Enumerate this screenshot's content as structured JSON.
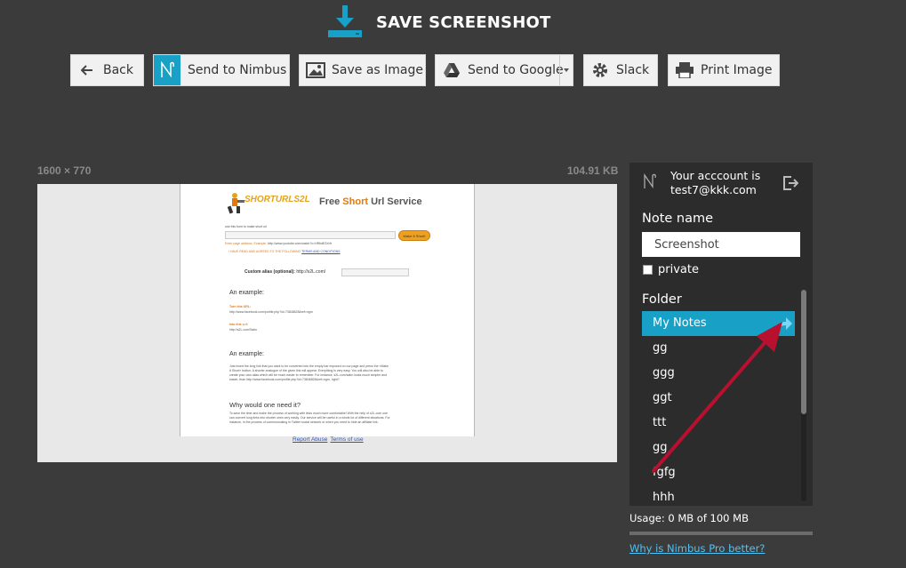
{
  "header": {
    "title": "SAVE SCREENSHOT",
    "icon": "download-icon",
    "accent": "#18a0c6"
  },
  "toolbar": {
    "back_label": "Back",
    "nimbus_label": "Send to Nimbus",
    "image_label": "Save as Image",
    "google_label": "Send to Google",
    "slack_label": "Slack",
    "print_label": "Print Image"
  },
  "preview": {
    "dimensions": "1600 × 770",
    "file_size": "104.91 KB",
    "page": {
      "logo_text": "SHORTURLS2L",
      "heading_free": "Free ",
      "heading_short": "Short",
      "heading_rest": " Url Service",
      "line_form": "use this form to make short url",
      "line_example": "Enter page address. Example:",
      "line_example_url": "http://www.youtube.com/watch?v=HRbdE3Xrfr",
      "make_button": "Make It Short!",
      "terms_text": "I HAVE READ AND AGREED TO THE FOLLOWING",
      "terms_link": "TERMS AND CONDITIONS",
      "alias_label": "Custom alias (optional):",
      "alias_prefix": "http://s2L.com/",
      "example_heading": "An example:",
      "turn_this": "Turn this URL:",
      "turn_url": "http://www.facebook.com/profile.php?id=73846828&ref=ngm",
      "into_this": "Into this s.rl:",
      "into_url": "http://s2L.com/Sabn",
      "example_heading2": "An example:",
      "para1_l1": "Just insert the long link that you want to be converted into the empty bar exposed on our page and press the «Make",
      "para1_l2": "It Short» button. A shorter analogue of the given link will appear. Everything is very easy. You will also be able to",
      "para1_l3": "create your own alias which will be much easier to remember. For instance, s2L.com/sabn looks much simpler and",
      "para1_l4": "easier, than http://www.facebook.com/profile.php?id=73846828&ref=ngm, right?",
      "why_heading": "Why would one need it?",
      "para2_l1": "To save the time and make the process of working with links much more comfortable! With the help of s2L.com one",
      "para2_l2": "can convert long links into shorter ones very easily. Our service will be useful in a whole lot of different situations: For",
      "para2_l3": "instance, in the process of communicating in Twitter social network or when you need to hide an affiliate link.",
      "report_link": "Report Abuse",
      "terms_footer": "Terms of use"
    }
  },
  "panel": {
    "account_line1": "Your acccount is",
    "account_email": "test7@kkk.com",
    "note_name_label": "Note name",
    "note_name_value": "Screenshot",
    "private_label": "private",
    "private_checked": false,
    "folder_label": "Folder",
    "folders": [
      "My Notes",
      "gg",
      "ggg",
      "ggt",
      "ttt",
      "gg",
      "fgfg",
      "hhh"
    ],
    "selected_folder": "My Notes"
  },
  "usage": {
    "text": "Usage: 0 MB of 100 MB",
    "fraction": 0
  },
  "pro_link": "Why is Nimbus Pro better?"
}
